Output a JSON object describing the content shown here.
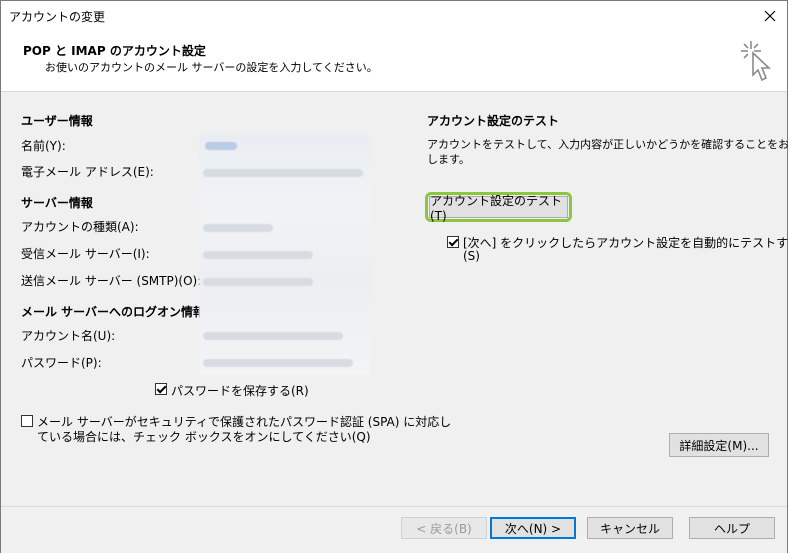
{
  "window": {
    "title": "アカウントの変更"
  },
  "header": {
    "title": "POP と IMAP のアカウント設定",
    "subtitle": "お使いのアカウントのメール サーバーの設定を入力してください。"
  },
  "left": {
    "user_info": "ユーザー情報",
    "name": "名前(Y):",
    "email": "電子メール アドレス(E):",
    "server_info": "サーバー情報",
    "account_type": "アカウントの種類(A):",
    "incoming": "受信メール サーバー(I):",
    "outgoing": "送信メール サーバー (SMTP)(O):",
    "logon_info": "メール サーバーへのログオン情報",
    "account_name": "アカウント名(U):",
    "password": "パスワード(P):",
    "remember_password": "パスワードを保存する(R)",
    "spa_line1": "メール サーバーがセキュリティで保護されたパスワード認証 (SPA) に対応し",
    "spa_line2": "ている場合には、チェック ボックスをオンにしてください(Q)"
  },
  "right": {
    "test_title": "アカウント設定のテスト",
    "test_desc_line1": "アカウントをテストして、入力内容が正しいかどうかを確認することをお勧め",
    "test_desc_line2": "します。",
    "test_button": "アカウント設定のテスト(T)",
    "auto_test_line1": "[次へ] をクリックしたらアカウント設定を自動的にテストする",
    "auto_test_line2": "(S)",
    "advanced_button": "詳細設定(M)..."
  },
  "footer": {
    "back": "< 戻る(B)",
    "next": "次へ(N) >",
    "cancel": "キャンセル",
    "help": "ヘルプ"
  },
  "checkboxes": {
    "remember_password": true,
    "spa": false,
    "auto_test": true
  }
}
